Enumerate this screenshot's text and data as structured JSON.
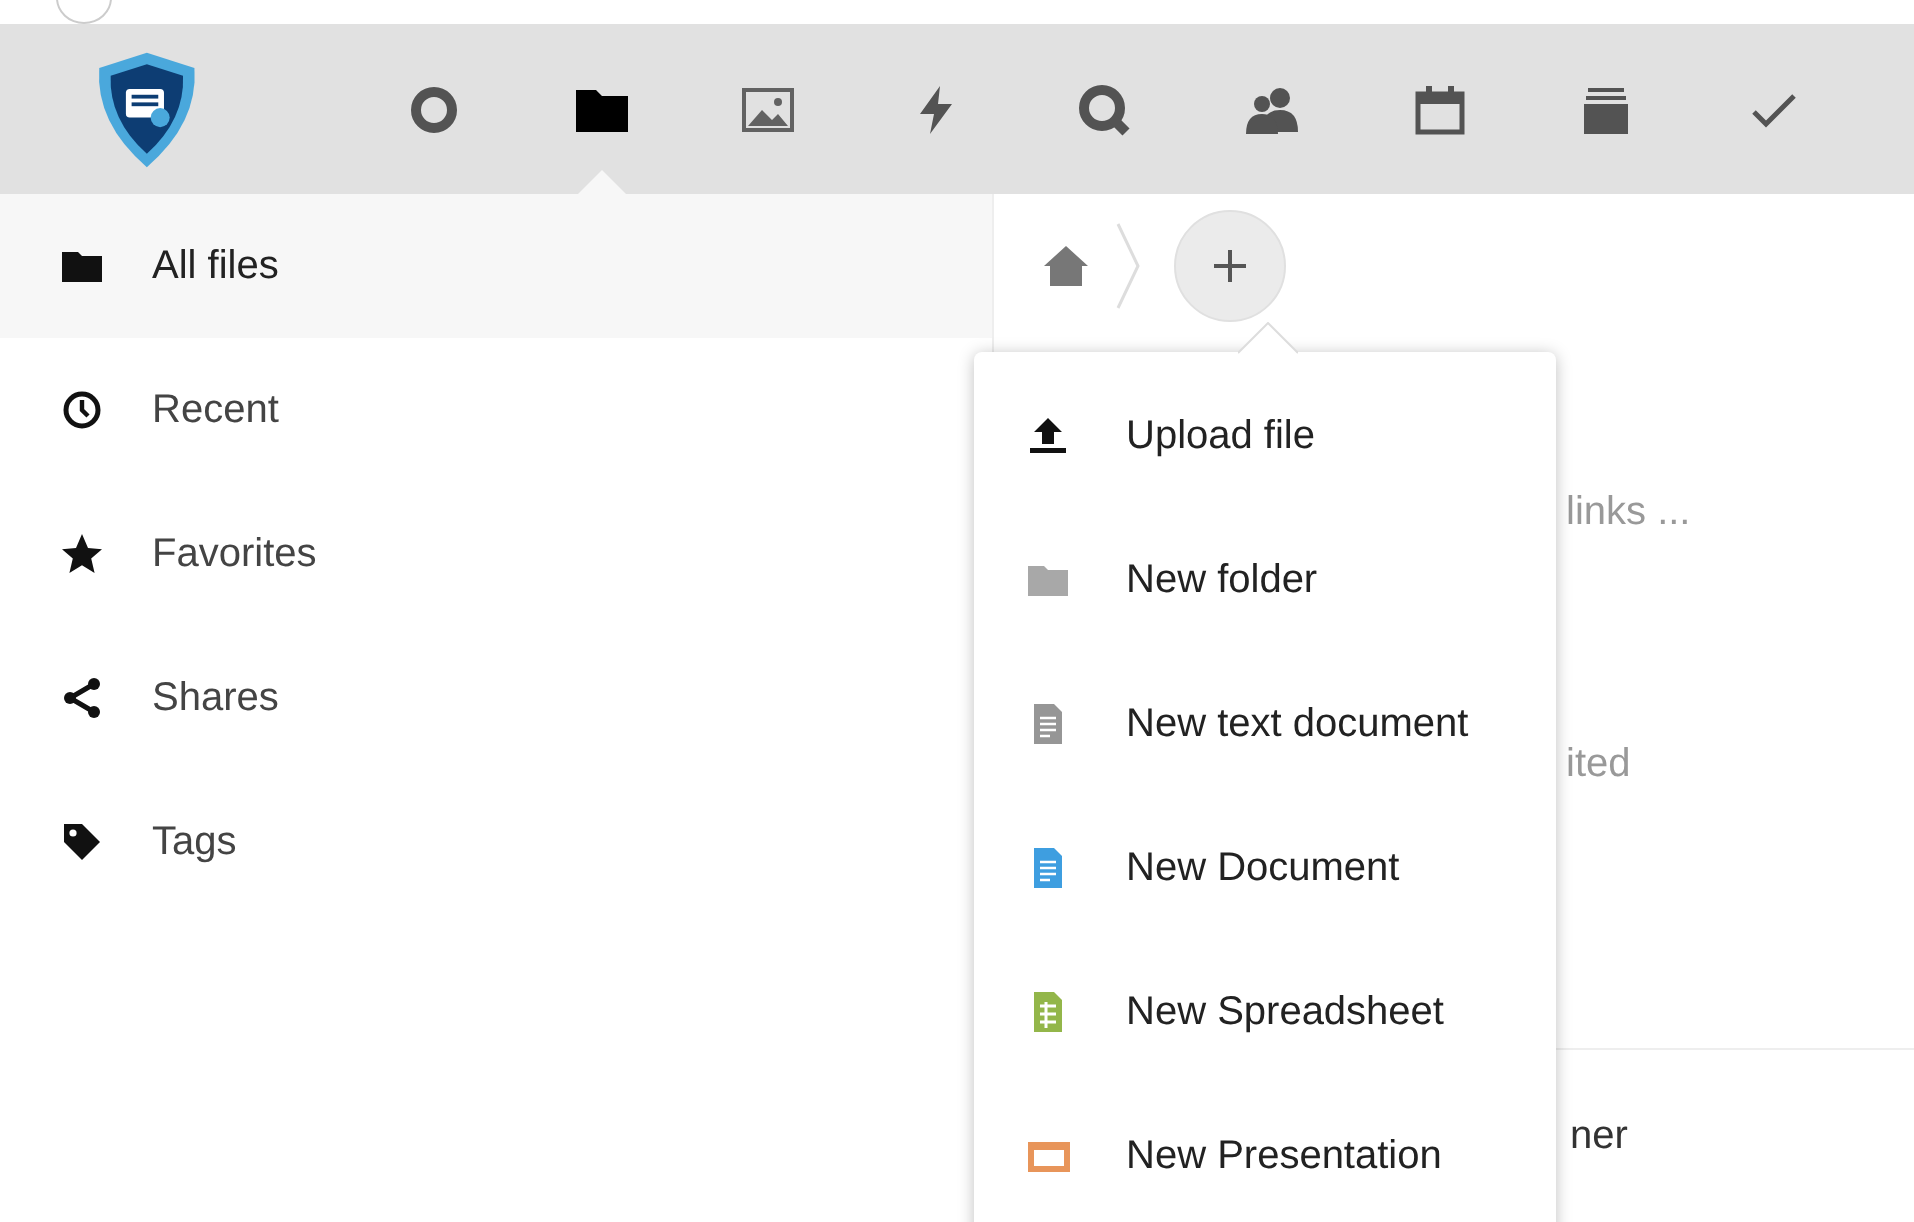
{
  "nav": [
    {
      "kind": "circle",
      "selected": false
    },
    {
      "kind": "folder",
      "selected": true
    },
    {
      "kind": "image",
      "selected": false
    },
    {
      "kind": "bolt",
      "selected": false
    },
    {
      "kind": "search",
      "selected": false
    },
    {
      "kind": "people",
      "selected": false
    },
    {
      "kind": "calendar",
      "selected": false
    },
    {
      "kind": "stack",
      "selected": false
    },
    {
      "kind": "check",
      "selected": false
    }
  ],
  "sidebar": {
    "items": [
      {
        "label": "All files",
        "kind": "folder",
        "selected": true
      },
      {
        "label": "Recent",
        "kind": "clock",
        "selected": false
      },
      {
        "label": "Favorites",
        "kind": "star",
        "selected": false
      },
      {
        "label": "Shares",
        "kind": "share",
        "selected": false
      },
      {
        "label": "Tags",
        "kind": "tag",
        "selected": false
      }
    ]
  },
  "background_texts": [
    "links ...",
    "ited",
    "ner"
  ],
  "new_menu": {
    "items": [
      {
        "label": "Upload file",
        "kind": "upload"
      },
      {
        "label": "New folder",
        "kind": "folder"
      },
      {
        "label": "New text document",
        "kind": "text"
      },
      {
        "label": "New Document",
        "kind": "document"
      },
      {
        "label": "New Spreadsheet",
        "kind": "spreadsheet"
      },
      {
        "label": "New Presentation",
        "kind": "presentation"
      }
    ]
  }
}
